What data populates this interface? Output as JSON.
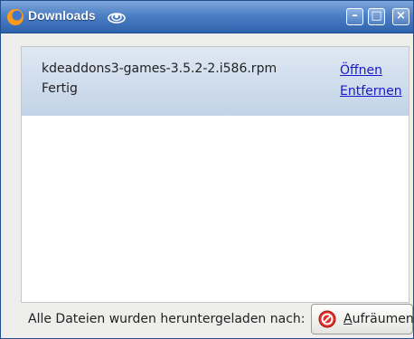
{
  "window": {
    "title": "Downloads",
    "controls": {
      "minimize": "–",
      "maximize": "□",
      "close": "×"
    }
  },
  "downloads": [
    {
      "filename": "kdeaddons3-games-3.5.2-2.i586.rpm",
      "status": "Fertig",
      "open_label": "Öffnen",
      "remove_label": "Entfernen"
    }
  ],
  "footer": {
    "saved_to_text": "Alle Dateien wurden heruntergeladen nach:",
    "cleanup_accel": "A",
    "cleanup_rest": "ufräumen"
  },
  "icons": {
    "app": "firefox-icon",
    "title_decoration": "swirl-icon",
    "cleanup": "no-entry-icon"
  },
  "colors": {
    "titlebar": "#4c7fc4",
    "item_background": "#c2d3e7",
    "link": "#1818cc",
    "cleanup_icon": "#e0302a"
  }
}
